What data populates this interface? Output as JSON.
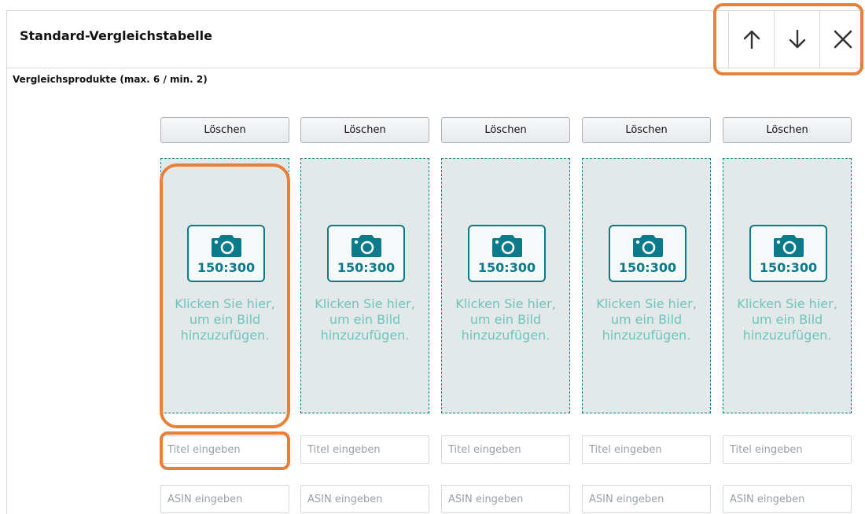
{
  "header": {
    "title": "Standard-Vergleichstabelle",
    "actions": [
      {
        "icon": "arrow-up-icon",
        "name": "move-up-button"
      },
      {
        "icon": "arrow-down-icon",
        "name": "move-down-button"
      },
      {
        "icon": "close-icon",
        "name": "close-button"
      }
    ]
  },
  "section": {
    "label": "Vergleichsprodukte (max. 6 / min. 2)"
  },
  "products": [
    {
      "delete_label": "Löschen",
      "ratio": "150:300",
      "upload_text": "Klicken Sie hier, um ein Bild hinzuzufügen.",
      "title_placeholder": "Titel eingeben",
      "asin_placeholder": "ASIN eingeben"
    },
    {
      "delete_label": "Löschen",
      "ratio": "150:300",
      "upload_text": "Klicken Sie hier, um ein Bild hinzuzufügen.",
      "title_placeholder": "Titel eingeben",
      "asin_placeholder": "ASIN eingeben"
    },
    {
      "delete_label": "Löschen",
      "ratio": "150:300",
      "upload_text": "Klicken Sie hier, um ein Bild hinzuzufügen.",
      "title_placeholder": "Titel eingeben",
      "asin_placeholder": "ASIN eingeben"
    },
    {
      "delete_label": "Löschen",
      "ratio": "150:300",
      "upload_text": "Klicken Sie hier, um ein Bild hinzuzufügen.",
      "title_placeholder": "Titel eingeben",
      "asin_placeholder": "ASIN eingeben"
    },
    {
      "delete_label": "Löschen",
      "ratio": "150:300",
      "upload_text": "Klicken Sie hier, um ein Bild hinzuzufügen.",
      "title_placeholder": "Titel eingeben",
      "asin_placeholder": "ASIN eingeben"
    }
  ],
  "colors": {
    "accent_teal": "#0b7a8a",
    "highlight_orange": "#e8803a",
    "slot_background": "#e3e9e9",
    "slot_text": "#6fc3bd"
  }
}
